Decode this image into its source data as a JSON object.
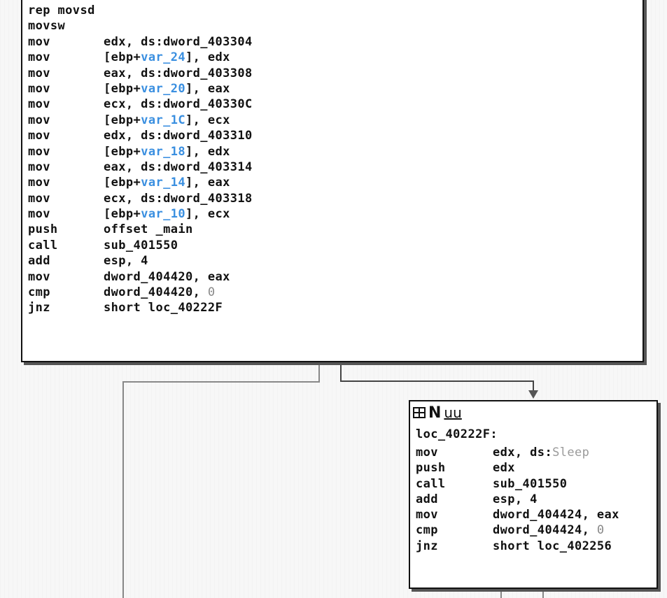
{
  "main_block": {
    "instructions": [
      {
        "mnemonic": "rep movsd",
        "operand": ""
      },
      {
        "mnemonic": "movsw",
        "operand": ""
      },
      {
        "mnemonic": "mov",
        "operand": "edx, ds:dword_403304"
      },
      {
        "mnemonic": "mov",
        "operand_pre": "[ebp+",
        "operand_var": "var_24",
        "operand_post": "], edx"
      },
      {
        "mnemonic": "mov",
        "operand": "eax, ds:dword_403308"
      },
      {
        "mnemonic": "mov",
        "operand_pre": "[ebp+",
        "operand_var": "var_20",
        "operand_post": "], eax"
      },
      {
        "mnemonic": "mov",
        "operand": "ecx, ds:dword_40330C"
      },
      {
        "mnemonic": "mov",
        "operand_pre": "[ebp+",
        "operand_var": "var_1C",
        "operand_post": "], ecx"
      },
      {
        "mnemonic": "mov",
        "operand": "edx, ds:dword_403310"
      },
      {
        "mnemonic": "mov",
        "operand_pre": "[ebp+",
        "operand_var": "var_18",
        "operand_post": "], edx"
      },
      {
        "mnemonic": "mov",
        "operand": "eax, ds:dword_403314"
      },
      {
        "mnemonic": "mov",
        "operand_pre": "[ebp+",
        "operand_var": "var_14",
        "operand_post": "], eax"
      },
      {
        "mnemonic": "mov",
        "operand": "ecx, ds:dword_403318"
      },
      {
        "mnemonic": "mov",
        "operand_pre": "[ebp+",
        "operand_var": "var_10",
        "operand_post": "], ecx"
      },
      {
        "mnemonic": "push",
        "operand": "offset _main"
      },
      {
        "mnemonic": "call",
        "operand": "sub_401550"
      },
      {
        "mnemonic": "add",
        "operand": "esp, 4"
      },
      {
        "mnemonic": "mov",
        "operand": "dword_404420, eax"
      },
      {
        "mnemonic": "cmp",
        "operand_pre": "dword_404420, ",
        "operand_dim": "0"
      },
      {
        "mnemonic": "jnz",
        "operand": "short loc_40222F"
      }
    ]
  },
  "loc_block": {
    "header_icons": [
      "graph-icon",
      "n-icon",
      "u-icon"
    ],
    "header_n": "N",
    "header_u": "uu",
    "label": "loc_40222F:",
    "instructions": [
      {
        "mnemonic": "mov",
        "operand_pre": "edx, ds:",
        "operand_ext": "Sleep"
      },
      {
        "mnemonic": "push",
        "operand": "edx"
      },
      {
        "mnemonic": "call",
        "operand": "sub_401550"
      },
      {
        "mnemonic": "add",
        "operand": "esp, 4"
      },
      {
        "mnemonic": "mov",
        "operand": "dword_404424, eax"
      },
      {
        "mnemonic": "cmp",
        "operand_pre": "dword_404424, ",
        "operand_dim": "0"
      },
      {
        "mnemonic": "jnz",
        "operand": "short loc_402256"
      }
    ]
  },
  "colors": {
    "text": "#111111",
    "local_var": "#3a8fe0",
    "external": "#9a9a9a",
    "edge": "#888888"
  }
}
